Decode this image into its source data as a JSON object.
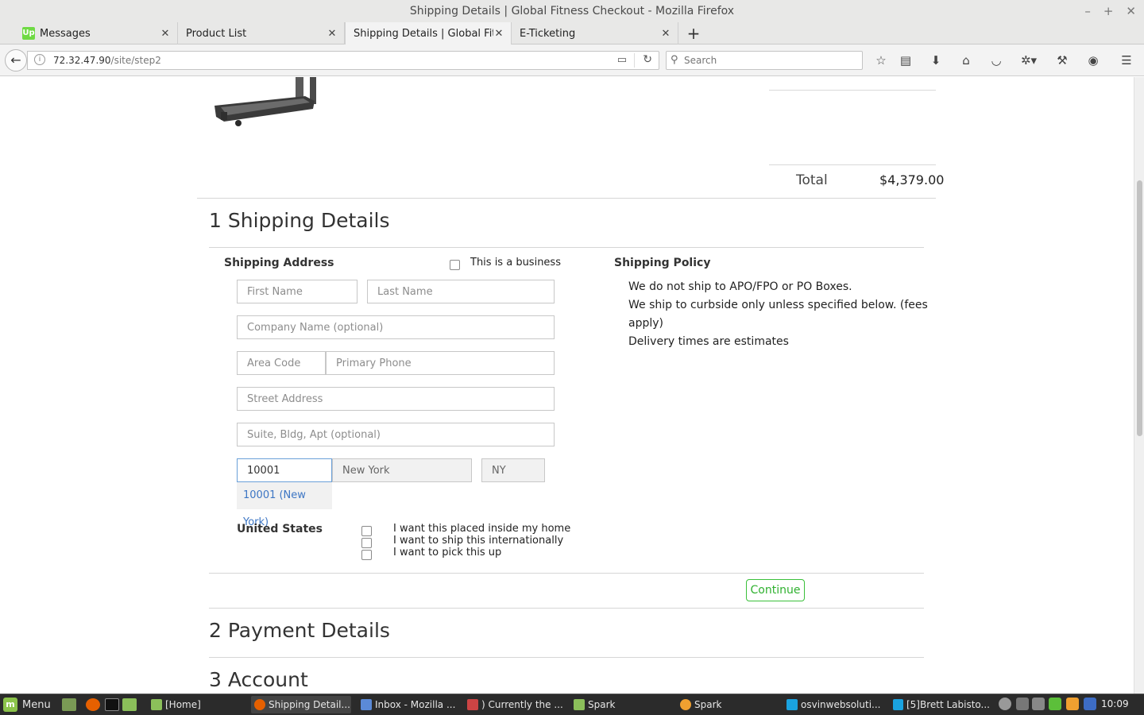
{
  "window": {
    "title": "Shipping Details | Global Fitness Checkout - Mozilla Firefox"
  },
  "tabs": [
    {
      "label": "Messages",
      "favicon": "Up"
    },
    {
      "label": "Product List"
    },
    {
      "label": "Shipping Details | Global Fitn..."
    },
    {
      "label": "E-Ticketing"
    }
  ],
  "nav": {
    "url_host": "72.32.47.90",
    "url_path": "/site/step2",
    "search_placeholder": "Search"
  },
  "cart": {
    "total_label": "Total",
    "total_value": "$4,379.00"
  },
  "sections": {
    "shipping": "1 Shipping Details",
    "payment": "2 Payment Details",
    "account": "3 Account"
  },
  "shipping_form": {
    "address_label": "Shipping Address",
    "business_label": "This is a business",
    "first_name_placeholder": "First Name",
    "last_name_placeholder": "Last Name",
    "company_placeholder": "Company Name (optional)",
    "area_code_placeholder": "Area Code",
    "phone_placeholder": "Primary Phone",
    "street_placeholder": "Street Address",
    "suite_placeholder": "Suite, Bldg, Apt (optional)",
    "zip_value": "10001",
    "city_value": "New York",
    "state_value": "NY",
    "autocomplete_suggestion": "10001 (New York)",
    "country": "United States",
    "inside_home_label": "I want this placed inside my home",
    "international_label": "I want to ship this internationally",
    "pickup_label": "I want to pick this up",
    "continue_label": "Continue"
  },
  "policy": {
    "title": "Shipping Policy",
    "line1": "We do not ship to APO/FPO or PO Boxes.",
    "line2": "We ship to curbside only unless specified below. (fees",
    "line3": "apply)",
    "line4": "Delivery times are estimates"
  },
  "taskbar": {
    "menu_label": "Menu",
    "items": [
      "[Home]",
      "Shipping Detail...",
      "Inbox - Mozilla ...",
      ") Currently the ...",
      "Spark",
      "Spark",
      "osvinwebsoluti...",
      "[5]Brett Labisto..."
    ],
    "clock": "10:09"
  }
}
